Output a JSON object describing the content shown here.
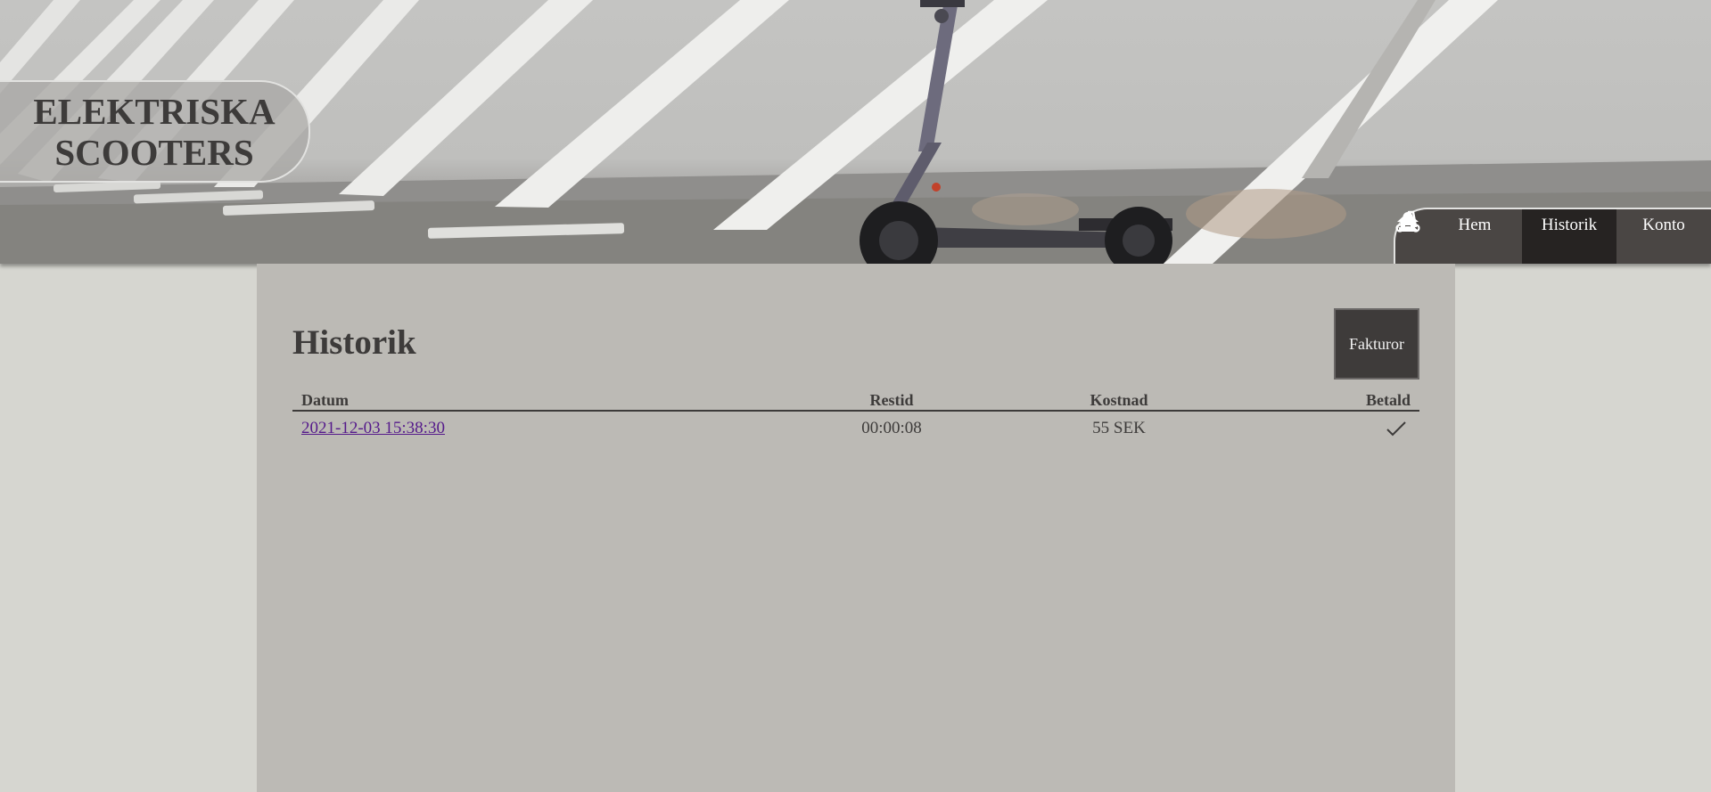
{
  "header": {
    "logo_text": "ELEKTRISKA\nSCOOTERS",
    "background": "scooter-photo"
  },
  "nav": {
    "items": [
      {
        "label": "Hem",
        "icon": "home-icon"
      },
      {
        "label": "Historik",
        "icon": "scooter-icon",
        "active": true
      },
      {
        "label": "Konto",
        "icon": "person-icon"
      }
    ]
  },
  "main": {
    "title": "Historik",
    "invoice_button": "Fakturor",
    "table": {
      "columns": [
        "Datum",
        "Restid",
        "Kostnad",
        "Betald"
      ],
      "rows": [
        {
          "datum": "2021-12-03 15:38:30",
          "restid": "00:00:08",
          "kostnad": "55 SEK",
          "betald": "check-icon"
        }
      ]
    }
  },
  "colors": {
    "page_bg": "#d6d6d0",
    "content_bg": "#bcbab5",
    "text": "#3d3b3a",
    "nav_bg": "#4a4644",
    "nav_active": "#262322",
    "link": "#551a8b"
  }
}
